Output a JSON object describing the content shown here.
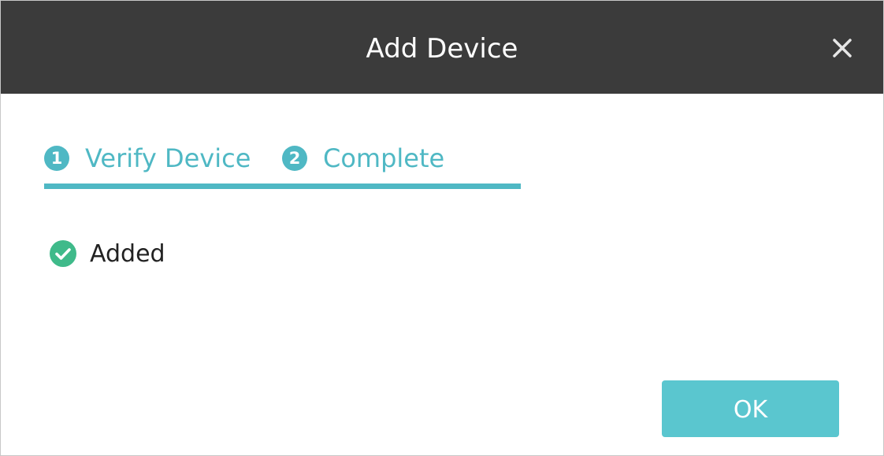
{
  "dialog": {
    "title": "Add Device",
    "close_icon": "close-icon"
  },
  "steps": [
    {
      "number": "1",
      "label": "Verify Device"
    },
    {
      "number": "2",
      "label": "Complete"
    }
  ],
  "progress": {
    "current_step": 2,
    "total_steps": 2
  },
  "status": {
    "icon": "check-circle-icon",
    "text": "Added"
  },
  "footer": {
    "ok_label": "OK"
  },
  "colors": {
    "titlebar": "#3b3b3b",
    "accent": "#4fb8c4",
    "button": "#5ac6cf",
    "success": "#3fba8a"
  }
}
